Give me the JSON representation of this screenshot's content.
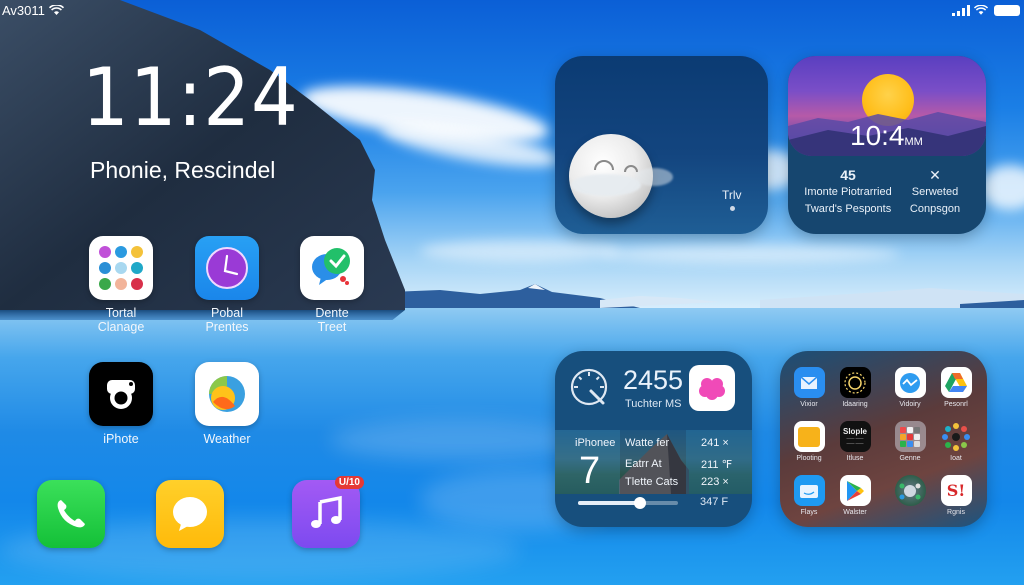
{
  "status_bar": {
    "carrier": "Av3011",
    "wifi_icon": "wifi-icon",
    "signal_icon": "cellular-signal-icon",
    "battery_icon": "battery-icon"
  },
  "lock": {
    "time": "11:24",
    "subtitle": "Phonie, Rescindel"
  },
  "apps": [
    {
      "label": "Tortal\nClanage",
      "icon": "app-folder-icon"
    },
    {
      "label": "Pobal\nPrentes",
      "icon": "clock-app-icon"
    },
    {
      "label": "Dente\nTreet",
      "icon": "chat-bubbles-icon"
    },
    {
      "label": "iPhote",
      "icon": "camera-icon"
    },
    {
      "label": "Weather",
      "icon": "weather-icon"
    }
  ],
  "dock": [
    {
      "name": "Phone",
      "icon": "phone-icon"
    },
    {
      "name": "Messages",
      "icon": "message-icon"
    },
    {
      "name": "Music",
      "icon": "music-note-icon",
      "badge": "U/10"
    }
  ],
  "weather_widget": {
    "label": "Trlv",
    "icon": "moon-cloud-icon"
  },
  "clock_widget": {
    "time": "10:4",
    "time_suffix": "MM",
    "left_value": "45",
    "left_line1": "Imonte Piotrarried",
    "left_line2": "Tward's Pesponts",
    "right_value": "✕",
    "right_line1": "Serweted",
    "right_line2": "Conpsgon"
  },
  "health_widget": {
    "value": "2455",
    "subtitle": "Tuchter MS",
    "band_left_label": "iPhonee",
    "band_left_big": "7",
    "rows": [
      {
        "name": "Watte fer",
        "value": "241 ×"
      },
      {
        "name": "Eatrr At",
        "value": "211 ℉"
      },
      {
        "name": "Tlette Cats",
        "value": "223 ×"
      }
    ],
    "slider_level": 0.62,
    "temperature": "347 F"
  },
  "apps_widget": {
    "items": [
      {
        "label": "Vixior",
        "icon": "mail-icon"
      },
      {
        "label": "Idaaring",
        "icon": "sun-dial-icon"
      },
      {
        "label": "Vidoiry",
        "icon": "wave-icon"
      },
      {
        "label": "Pesonrl",
        "icon": "drive-icon"
      },
      {
        "label": "Plooting",
        "icon": "folder-icon"
      },
      {
        "label": "Itluse",
        "icon": "slople-icon"
      },
      {
        "label": "Genne",
        "icon": "app-folder-icon"
      },
      {
        "label": "Ioat",
        "icon": "circle-apps-icon"
      },
      {
        "label": "Flays",
        "icon": "files-icon"
      },
      {
        "label": "Walster",
        "icon": "play-store-icon"
      },
      {
        "label": "",
        "icon": "round-collage-icon"
      },
      {
        "label": "Rgnis",
        "icon": "s-logo-icon"
      }
    ],
    "tile_text": "Slople"
  }
}
